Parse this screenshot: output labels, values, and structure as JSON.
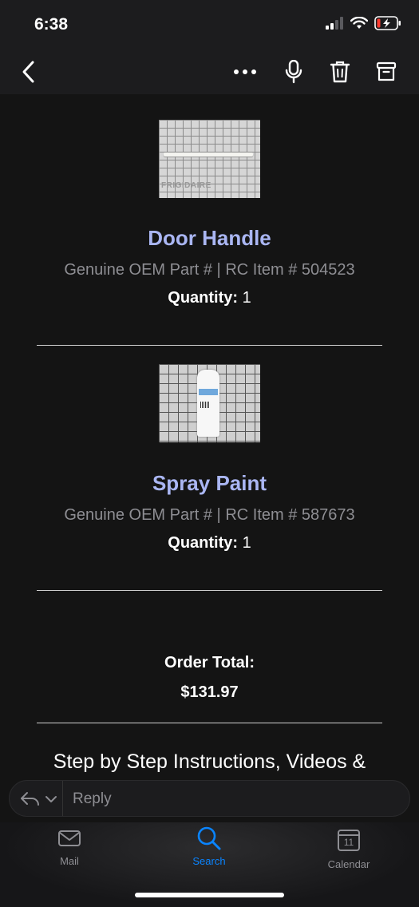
{
  "status_bar": {
    "time": "6:38"
  },
  "toolbar": {
    "back_icon": "chevron-left-icon",
    "more_icon": "more-icon",
    "mic_icon": "microphone-icon",
    "trash_icon": "trash-icon",
    "archive_icon": "archive-icon"
  },
  "products": [
    {
      "title": "Door Handle",
      "subtitle": "Genuine OEM Part # | RC Item # 504523",
      "qty_label": "Quantity:",
      "qty_value": "1",
      "image_text": "FRIGIDAIRE"
    },
    {
      "title": "Spray Paint",
      "subtitle": "Genuine OEM Part # | RC Item # 587673",
      "qty_label": "Quantity:",
      "qty_value": "1"
    }
  ],
  "order": {
    "label": "Order Total:",
    "value": "$131.97"
  },
  "footer_text": "Step by Step Instructions, Videos &",
  "reply": {
    "placeholder": "Reply"
  },
  "tabs": [
    {
      "label": "Mail",
      "icon": "mail-icon"
    },
    {
      "label": "Search",
      "icon": "search-icon"
    },
    {
      "label": "Calendar",
      "icon": "calendar-icon",
      "day": "11"
    }
  ],
  "colors": {
    "accent_blue": "#0a84ff",
    "title_blue": "#aab6f3",
    "muted_gray": "#8e8e93"
  }
}
